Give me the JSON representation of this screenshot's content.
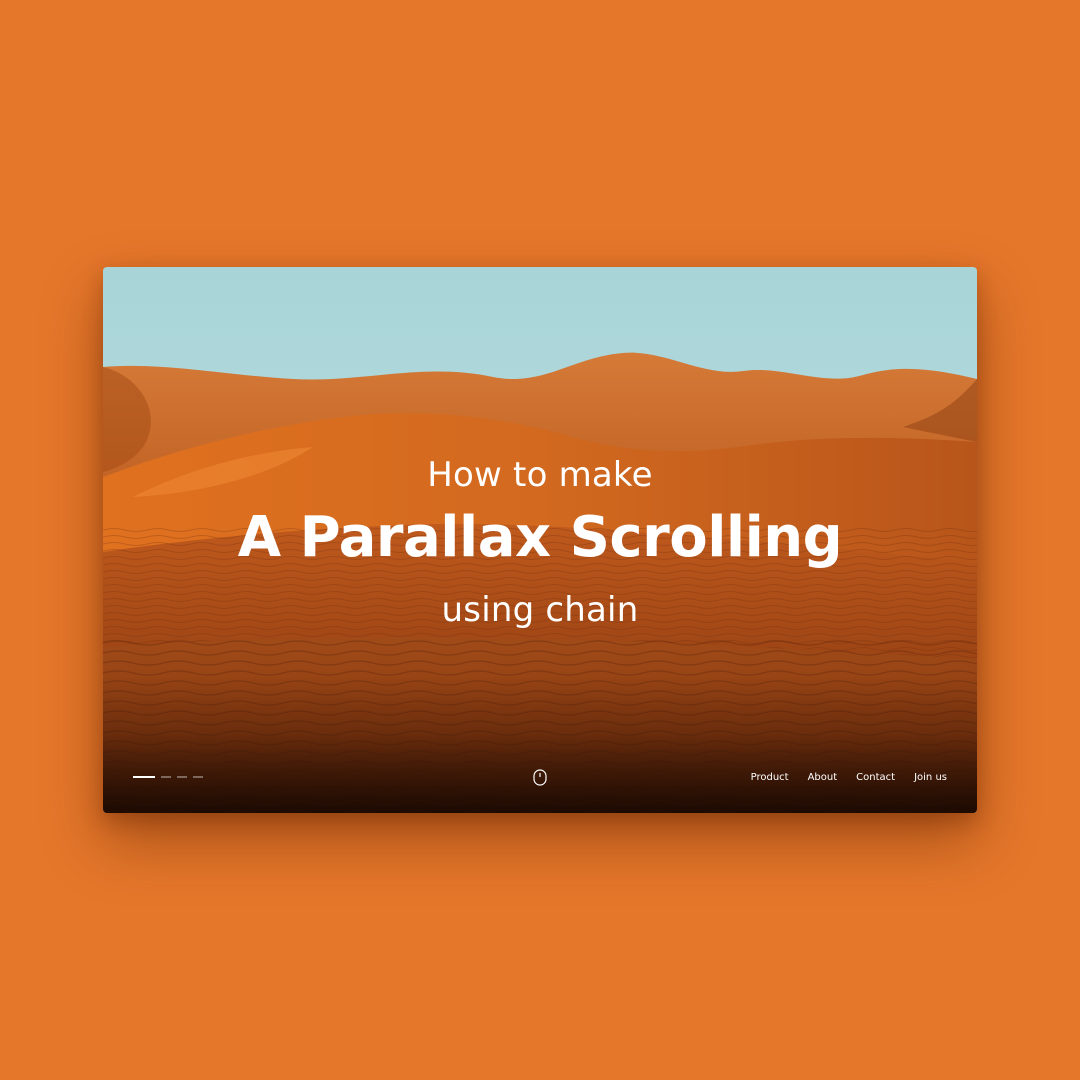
{
  "hero": {
    "eyebrow": "How to make",
    "title": "A Parallax Scrolling",
    "subtitle": "using chain"
  },
  "pager": {
    "total": 4,
    "active": 1
  },
  "scroll_indicator": {
    "icon": "mouse-icon"
  },
  "nav": {
    "items": [
      {
        "label": "Product"
      },
      {
        "label": "About"
      },
      {
        "label": "Contact"
      },
      {
        "label": "Join us"
      }
    ]
  },
  "colors": {
    "page_background": "#E5772A",
    "sky": "#A9D6DA",
    "dune_light": "#D0651F",
    "dune_dark": "#5A2208",
    "text": "#FFFFFF"
  }
}
